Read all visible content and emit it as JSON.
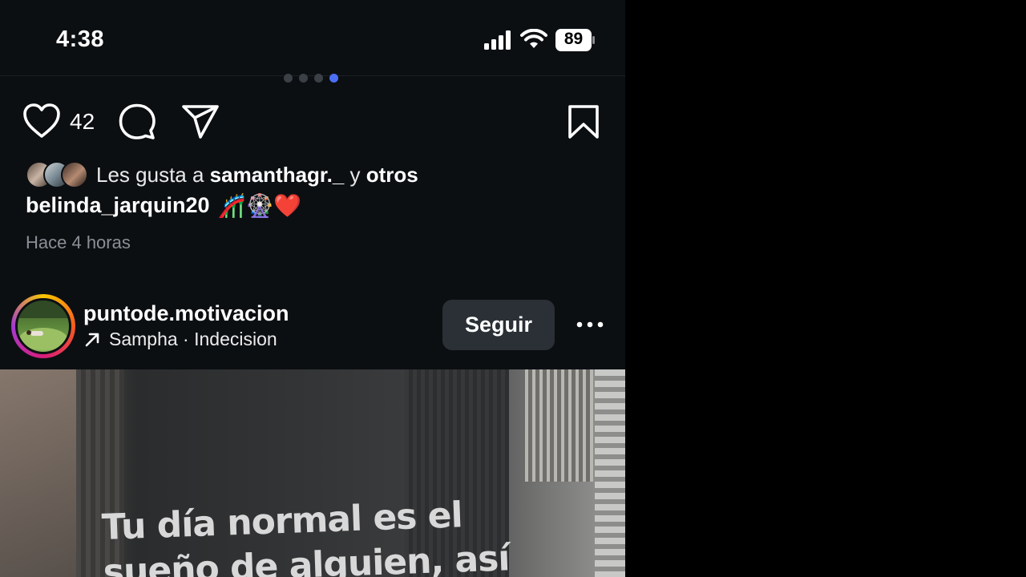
{
  "status_bar": {
    "time": "4:38",
    "battery": "89"
  },
  "carousel": {
    "dot_count": 4,
    "active_index": 3
  },
  "post": {
    "like_count": "42",
    "liked_by_prefix": "Les gusta a ",
    "liked_by_user": "samanthagr._",
    "liked_by_joiner": " y ",
    "liked_by_others": "otros",
    "caption_user": "belinda_jarquin20",
    "caption_text": "🎢🎡❤️",
    "timestamp": "Hace 4 horas"
  },
  "next_post": {
    "username": "puntode.motivacion",
    "music": "Sampha · Indecision",
    "follow_label": "Seguir",
    "quote_line1": "Tu día normal es el",
    "quote_line2": "sueño de alguien, así"
  },
  "icons": {
    "like": "heart-icon",
    "comment": "comment-icon",
    "share": "send-icon",
    "save": "bookmark-icon",
    "more": "more-icon",
    "music": "arrow-up-right-icon"
  },
  "colors": {
    "background": "#0c0f12",
    "accent_dot": "#4c6ef5",
    "follow_button": "#2a3035"
  }
}
